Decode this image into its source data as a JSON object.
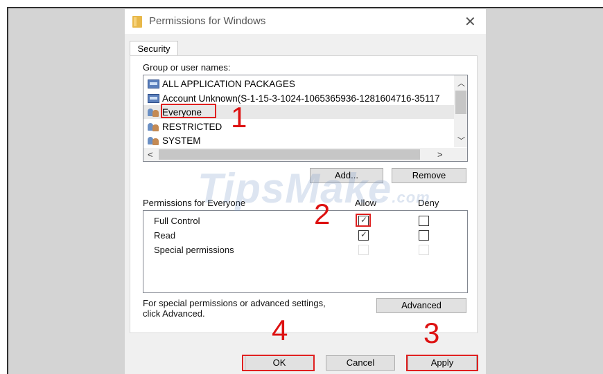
{
  "window": {
    "title": "Permissions for Windows",
    "close_glyph": "✕"
  },
  "tabs": [
    {
      "label": "Security"
    }
  ],
  "group_label": "Group or user names:",
  "users": [
    {
      "name": "ALL APPLICATION PACKAGES",
      "icon": "package-icon"
    },
    {
      "name": "Account Unknown(S-1-15-3-1024-1065365936-1281604716-35117",
      "icon": "user-group-icon"
    },
    {
      "name": "Everyone",
      "icon": "user-group-icon",
      "selected": true
    },
    {
      "name": "RESTRICTED",
      "icon": "user-group-icon"
    },
    {
      "name": "SYSTEM",
      "icon": "user-group-icon"
    }
  ],
  "buttons": {
    "add": "Add...",
    "remove": "Remove",
    "advanced": "Advanced",
    "ok": "OK",
    "cancel": "Cancel",
    "apply": "Apply"
  },
  "permissions": {
    "header": "Permissions for Everyone",
    "allow_label": "Allow",
    "deny_label": "Deny",
    "rows": [
      {
        "name": "Full Control",
        "allow": true,
        "deny": false,
        "disabled": false
      },
      {
        "name": "Read",
        "allow": true,
        "deny": false,
        "disabled": false
      },
      {
        "name": "Special permissions",
        "allow": false,
        "deny": false,
        "disabled": true
      }
    ]
  },
  "advanced_text": [
    "For special permissions or advanced settings,",
    "click Advanced."
  ],
  "annotations": [
    "1",
    "2",
    "3",
    "4"
  ],
  "watermark": {
    "main": "TipsMake",
    "suffix": ".com"
  },
  "colors": {
    "annotation_red": "#e02020",
    "background": "#d4d4d4"
  }
}
